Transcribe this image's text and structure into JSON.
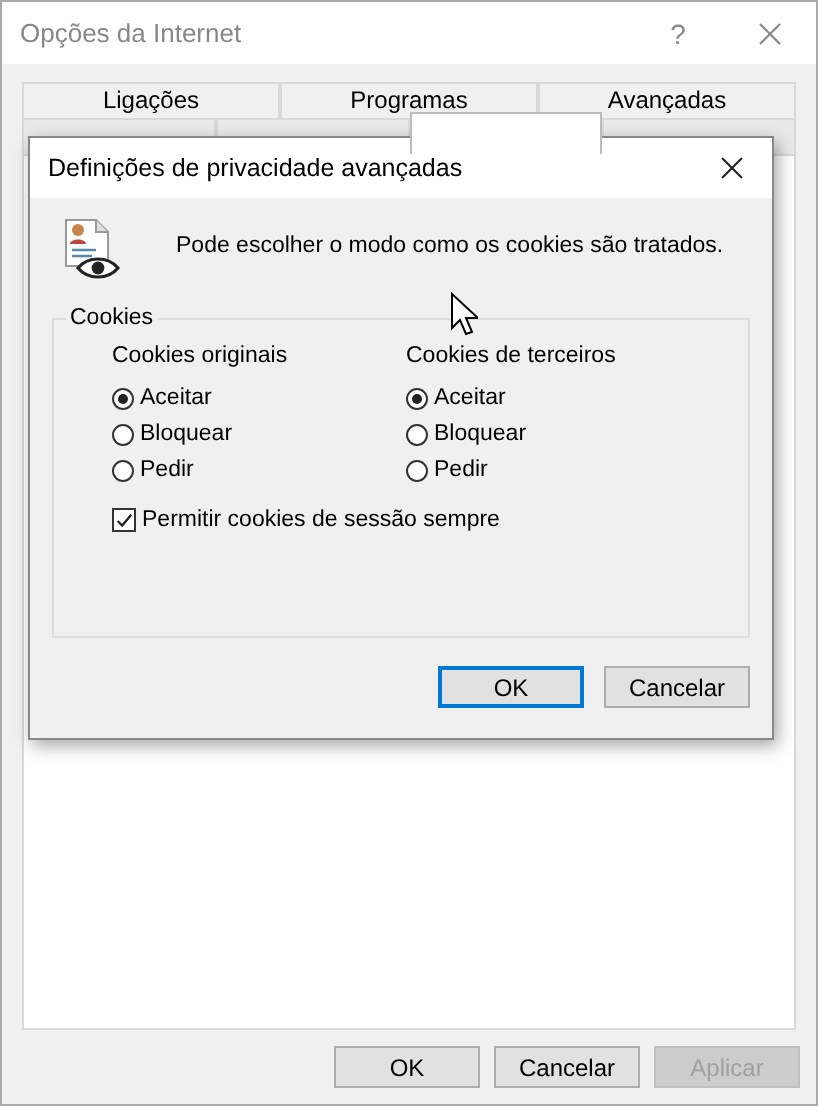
{
  "window": {
    "title": "Opções da Internet",
    "help": "?"
  },
  "tab_rows": [
    [
      {
        "label": "Ligações",
        "selected": false
      },
      {
        "label": "Programas",
        "selected": false
      },
      {
        "label": "Avançadas",
        "selected": false
      }
    ],
    [
      {
        "selected": false
      },
      {
        "selected": false
      },
      {
        "selected": true
      },
      {
        "selected": false
      }
    ]
  ],
  "buttons": [
    {
      "label": "OK",
      "disabled": false
    },
    {
      "label": "Cancelar",
      "disabled": false
    },
    {
      "label": "Aplicar",
      "disabled": true
    }
  ],
  "dialog": {
    "title": "Definições de privacidade avançadas",
    "description": "Pode escolher o modo como os cookies são tratados.",
    "group": {
      "label": "Cookies",
      "columns": [
        {
          "heading": "Cookies originais",
          "options": [
            {
              "label": "Aceitar",
              "selected": true
            },
            {
              "label": "Bloquear",
              "selected": false
            },
            {
              "label": "Pedir",
              "selected": false
            }
          ]
        },
        {
          "heading": "Cookies de terceiros",
          "options": [
            {
              "label": "Aceitar",
              "selected": true
            },
            {
              "label": "Bloquear",
              "selected": false
            },
            {
              "label": "Pedir",
              "selected": false
            }
          ]
        }
      ],
      "checkbox": {
        "label": "Permitir cookies de sessão sempre",
        "checked": true
      }
    },
    "buttons": [
      {
        "label": "OK",
        "default": true
      },
      {
        "label": "Cancelar",
        "default": false
      }
    ]
  }
}
